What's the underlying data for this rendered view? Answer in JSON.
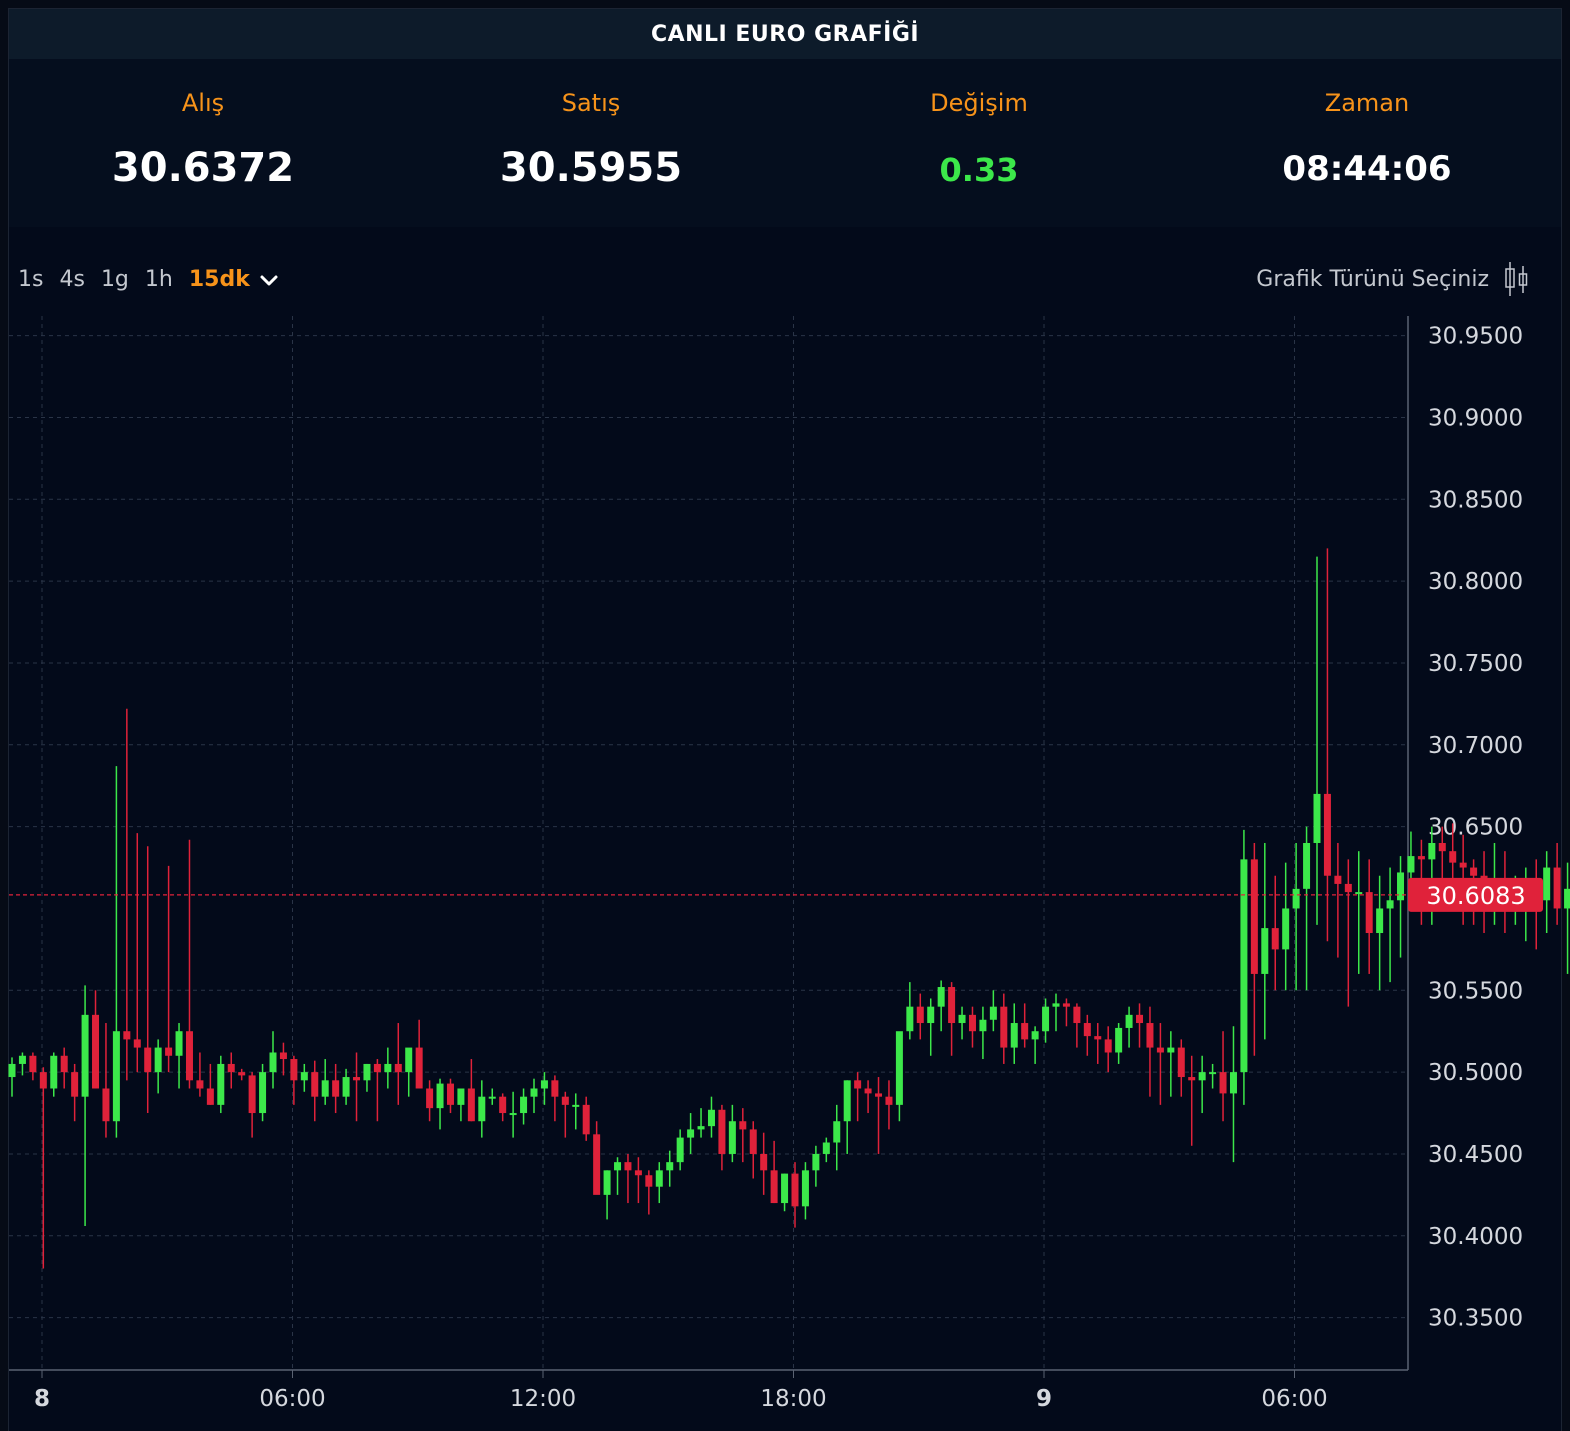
{
  "header": {
    "title": "CANLI EURO GRAFİĞİ"
  },
  "stats": [
    {
      "label": "Alış",
      "value": "30.6372"
    },
    {
      "label": "Satış",
      "value": "30.5955"
    },
    {
      "label": "Değişim",
      "value": "0.33"
    },
    {
      "label": "Zaman",
      "value": "08:44:06"
    }
  ],
  "toolbar": {
    "intervals": [
      "1s",
      "4s",
      "1g",
      "1h"
    ],
    "active_interval": "15dk",
    "dropdown_icon": "chevron-down-icon",
    "chart_type_label": "Grafik Türünü Seçiniz",
    "chart_type_icon": "candlestick-icon"
  },
  "colors": {
    "up": "#3ce84a",
    "down": "#e0223a",
    "accent": "#f7931a",
    "last_price_bg": "#e0223a"
  },
  "chart_data": {
    "type": "candlestick",
    "y_ticks": [
      "30.9500",
      "30.9000",
      "30.8500",
      "30.8000",
      "30.7500",
      "30.7000",
      "30.6500",
      "30.5500",
      "30.5000",
      "30.4500",
      "30.4000",
      "30.3500"
    ],
    "x_ticks": [
      "8",
      "06:00",
      "12:00",
      "18:00",
      "9",
      "06:00"
    ],
    "ylim": [
      30.318,
      30.962
    ],
    "last_price": "30.6083",
    "grid": true,
    "interval_minutes": 15,
    "candles": [
      [
        30.497,
        30.509,
        30.485,
        30.505
      ],
      [
        30.505,
        30.512,
        30.498,
        30.51
      ],
      [
        30.51,
        30.512,
        30.495,
        30.5
      ],
      [
        30.5,
        30.503,
        30.38,
        30.49
      ],
      [
        30.49,
        30.512,
        30.485,
        30.51
      ],
      [
        30.51,
        30.515,
        30.49,
        30.5
      ],
      [
        30.5,
        30.505,
        30.47,
        30.485
      ],
      [
        30.485,
        30.553,
        30.406,
        30.535
      ],
      [
        30.535,
        30.55,
        30.49,
        30.49
      ],
      [
        30.49,
        30.53,
        30.46,
        30.47
      ],
      [
        30.47,
        30.687,
        30.46,
        30.525
      ],
      [
        30.525,
        30.722,
        30.495,
        30.52
      ],
      [
        30.52,
        30.646,
        30.5,
        30.515
      ],
      [
        30.515,
        30.638,
        30.475,
        30.5
      ],
      [
        30.5,
        30.52,
        30.487,
        30.515
      ],
      [
        30.515,
        30.626,
        30.5,
        30.51
      ],
      [
        30.51,
        30.53,
        30.49,
        30.525
      ],
      [
        30.525,
        30.642,
        30.49,
        30.495
      ],
      [
        30.495,
        30.512,
        30.485,
        30.49
      ],
      [
        30.49,
        30.505,
        30.48,
        30.48
      ],
      [
        30.48,
        30.51,
        30.475,
        30.505
      ],
      [
        30.505,
        30.512,
        30.49,
        30.5
      ],
      [
        30.5,
        30.502,
        30.495,
        30.498
      ],
      [
        30.498,
        30.5,
        30.46,
        30.475
      ],
      [
        30.475,
        30.505,
        30.47,
        30.5
      ],
      [
        30.5,
        30.525,
        30.49,
        30.512
      ],
      [
        30.512,
        30.518,
        30.498,
        30.508
      ],
      [
        30.508,
        30.51,
        30.48,
        30.495
      ],
      [
        30.495,
        30.505,
        30.488,
        30.5
      ],
      [
        30.5,
        30.507,
        30.47,
        30.485
      ],
      [
        30.485,
        30.508,
        30.48,
        30.495
      ],
      [
        30.495,
        30.505,
        30.475,
        30.485
      ],
      [
        30.485,
        30.502,
        30.48,
        30.497
      ],
      [
        30.497,
        30.512,
        30.47,
        30.495
      ],
      [
        30.495,
        30.505,
        30.488,
        30.505
      ],
      [
        30.505,
        30.508,
        30.47,
        30.5
      ],
      [
        30.5,
        30.515,
        30.49,
        30.505
      ],
      [
        30.505,
        30.53,
        30.48,
        30.5
      ],
      [
        30.5,
        30.512,
        30.485,
        30.515
      ],
      [
        30.515,
        30.532,
        30.495,
        30.49
      ],
      [
        30.49,
        30.495,
        30.47,
        30.478
      ],
      [
        30.478,
        30.496,
        30.465,
        30.493
      ],
      [
        30.493,
        30.496,
        30.475,
        30.48
      ],
      [
        30.48,
        30.49,
        30.47,
        30.49
      ],
      [
        30.49,
        30.508,
        30.47,
        30.47
      ],
      [
        30.47,
        30.495,
        30.46,
        30.485
      ],
      [
        30.485,
        30.49,
        30.48,
        30.485
      ],
      [
        30.485,
        30.487,
        30.47,
        30.475
      ],
      [
        30.475,
        30.488,
        30.46,
        30.475
      ],
      [
        30.475,
        30.49,
        30.468,
        30.485
      ],
      [
        30.485,
        30.496,
        30.475,
        30.49
      ],
      [
        30.49,
        30.5,
        30.48,
        30.495
      ],
      [
        30.495,
        30.498,
        30.47,
        30.485
      ],
      [
        30.485,
        30.488,
        30.46,
        30.48
      ],
      [
        30.48,
        30.487,
        30.465,
        30.48
      ],
      [
        30.48,
        30.485,
        30.458,
        30.462
      ],
      [
        30.462,
        30.47,
        30.43,
        30.425
      ],
      [
        30.425,
        30.44,
        30.41,
        30.44
      ],
      [
        30.44,
        30.448,
        30.425,
        30.445
      ],
      [
        30.445,
        30.45,
        30.42,
        30.44
      ],
      [
        30.44,
        30.448,
        30.42,
        30.437
      ],
      [
        30.437,
        30.44,
        30.413,
        30.43
      ],
      [
        30.43,
        30.445,
        30.42,
        30.44
      ],
      [
        30.44,
        30.452,
        30.43,
        30.445
      ],
      [
        30.445,
        30.465,
        30.44,
        30.46
      ],
      [
        30.46,
        30.475,
        30.45,
        30.465
      ],
      [
        30.465,
        30.478,
        30.46,
        30.467
      ],
      [
        30.467,
        30.485,
        30.46,
        30.477
      ],
      [
        30.477,
        30.48,
        30.44,
        30.45
      ],
      [
        30.45,
        30.48,
        30.445,
        30.47
      ],
      [
        30.47,
        30.478,
        30.445,
        30.465
      ],
      [
        30.465,
        30.47,
        30.435,
        30.45
      ],
      [
        30.45,
        30.463,
        30.425,
        30.44
      ],
      [
        30.44,
        30.458,
        30.42,
        30.42
      ],
      [
        30.42,
        30.438,
        30.415,
        30.438
      ],
      [
        30.438,
        30.445,
        30.405,
        30.418
      ],
      [
        30.418,
        30.445,
        30.41,
        30.44
      ],
      [
        30.44,
        30.455,
        30.43,
        30.45
      ],
      [
        30.45,
        30.46,
        30.445,
        30.457
      ],
      [
        30.457,
        30.48,
        30.44,
        30.47
      ],
      [
        30.47,
        30.495,
        30.45,
        30.495
      ],
      [
        30.495,
        30.5,
        30.47,
        30.49
      ],
      [
        30.49,
        30.495,
        30.475,
        30.487
      ],
      [
        30.487,
        30.497,
        30.45,
        30.485
      ],
      [
        30.485,
        30.495,
        30.465,
        30.48
      ],
      [
        30.48,
        30.52,
        30.47,
        30.525
      ],
      [
        30.525,
        30.555,
        30.52,
        30.54
      ],
      [
        30.54,
        30.548,
        30.52,
        30.53
      ],
      [
        30.53,
        30.545,
        30.51,
        30.54
      ],
      [
        30.54,
        30.556,
        30.525,
        30.552
      ],
      [
        30.552,
        30.555,
        30.51,
        30.53
      ],
      [
        30.53,
        30.54,
        30.52,
        30.535
      ],
      [
        30.535,
        30.54,
        30.515,
        30.525
      ],
      [
        30.525,
        30.54,
        30.508,
        30.532
      ],
      [
        30.532,
        30.55,
        30.525,
        30.54
      ],
      [
        30.54,
        30.548,
        30.505,
        30.515
      ],
      [
        30.515,
        30.542,
        30.505,
        30.53
      ],
      [
        30.53,
        30.542,
        30.515,
        30.52
      ],
      [
        30.52,
        30.528,
        30.505,
        30.525
      ],
      [
        30.525,
        30.545,
        30.518,
        30.54
      ],
      [
        30.54,
        30.548,
        30.525,
        30.542
      ],
      [
        30.542,
        30.545,
        30.528,
        30.54
      ],
      [
        30.54,
        30.542,
        30.515,
        30.53
      ],
      [
        30.53,
        30.535,
        30.51,
        30.522
      ],
      [
        30.522,
        30.53,
        30.505,
        30.52
      ],
      [
        30.52,
        30.528,
        30.5,
        30.512
      ],
      [
        30.512,
        30.53,
        30.505,
        30.527
      ],
      [
        30.527,
        30.54,
        30.515,
        30.535
      ],
      [
        30.535,
        30.542,
        30.515,
        30.53
      ],
      [
        30.53,
        30.54,
        30.485,
        30.515
      ],
      [
        30.515,
        30.53,
        30.48,
        30.512
      ],
      [
        30.512,
        30.525,
        30.485,
        30.515
      ],
      [
        30.515,
        30.52,
        30.485,
        30.497
      ],
      [
        30.497,
        30.51,
        30.455,
        30.495
      ],
      [
        30.495,
        30.51,
        30.475,
        30.5
      ],
      [
        30.5,
        30.505,
        30.49,
        30.5
      ],
      [
        30.5,
        30.525,
        30.47,
        30.487
      ],
      [
        30.487,
        30.528,
        30.445,
        30.5
      ],
      [
        30.5,
        30.648,
        30.48,
        30.63
      ],
      [
        30.63,
        30.64,
        30.51,
        30.56
      ],
      [
        30.56,
        30.64,
        30.52,
        30.588
      ],
      [
        30.588,
        30.62,
        30.55,
        30.575
      ],
      [
        30.575,
        30.628,
        30.55,
        30.6
      ],
      [
        30.6,
        30.64,
        30.55,
        30.612
      ],
      [
        30.612,
        30.65,
        30.55,
        30.64
      ],
      [
        30.64,
        30.815,
        30.59,
        30.67
      ],
      [
        30.67,
        30.82,
        30.58,
        30.62
      ],
      [
        30.62,
        30.64,
        30.57,
        30.615
      ],
      [
        30.615,
        30.63,
        30.54,
        30.61
      ],
      [
        30.61,
        30.635,
        30.56,
        30.61
      ],
      [
        30.61,
        30.63,
        30.56,
        30.585
      ],
      [
        30.585,
        30.62,
        30.55,
        30.6
      ],
      [
        30.6,
        30.625,
        30.555,
        30.605
      ],
      [
        30.605,
        30.632,
        30.57,
        30.622
      ],
      [
        30.622,
        30.647,
        30.6,
        30.632
      ],
      [
        30.632,
        30.642,
        30.59,
        30.63
      ],
      [
        30.63,
        30.65,
        30.59,
        30.64
      ],
      [
        30.64,
        30.65,
        30.605,
        30.635
      ],
      [
        30.635,
        30.652,
        30.6,
        30.628
      ],
      [
        30.628,
        30.645,
        30.59,
        30.625
      ],
      [
        30.625,
        30.63,
        30.59,
        30.62
      ],
      [
        30.62,
        30.635,
        30.585,
        30.615
      ],
      [
        30.615,
        30.64,
        30.59,
        30.615
      ],
      [
        30.615,
        30.635,
        30.585,
        30.61
      ],
      [
        30.61,
        30.62,
        30.59,
        30.612
      ],
      [
        30.612,
        30.625,
        30.58,
        30.615
      ],
      [
        30.615,
        30.63,
        30.575,
        30.605
      ],
      [
        30.605,
        30.635,
        30.585,
        30.625
      ],
      [
        30.625,
        30.64,
        30.59,
        30.6
      ],
      [
        30.6,
        30.628,
        30.56,
        30.612
      ],
      [
        30.612,
        30.63,
        30.55,
        30.615
      ],
      [
        30.615,
        30.638,
        30.59,
        30.605
      ],
      [
        30.605,
        30.63,
        30.59,
        30.608
      ]
    ]
  }
}
